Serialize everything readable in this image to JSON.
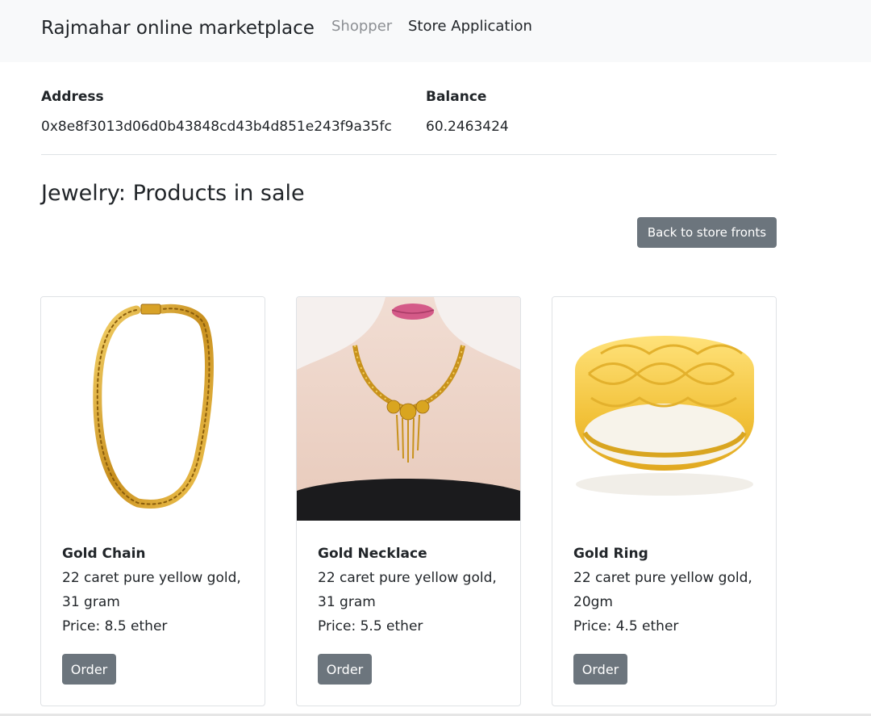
{
  "navbar": {
    "brand": "Rajmahar online marketplace",
    "links": [
      {
        "label": "Shopper"
      },
      {
        "label": "Store Application"
      }
    ]
  },
  "account": {
    "address_label": "Address",
    "address_value": "0x8e8f3013d06d0b43848cd43b4d851e243f9a35fc",
    "balance_label": "Balance",
    "balance_value": "60.2463424"
  },
  "page": {
    "title": "Jewelry: Products in sale",
    "back_button": "Back to store fronts"
  },
  "products": [
    {
      "name": "Gold Chain",
      "description": "22 caret pure yellow gold, 31 gram",
      "price": "Price: 8.5 ether",
      "order_label": "Order",
      "image": "gold-chain-image"
    },
    {
      "name": "Gold Necklace",
      "description": "22 caret pure yellow gold, 31 gram",
      "price": "Price: 5.5 ether",
      "order_label": "Order",
      "image": "gold-necklace-image"
    },
    {
      "name": "Gold Ring",
      "description": "22 caret pure yellow gold, 20gm",
      "price": "Price: 4.5 ether",
      "order_label": "Order",
      "image": "gold-ring-image"
    }
  ],
  "colors": {
    "navbar_bg": "#f8f9fa",
    "button_bg": "#6c757d",
    "gold": "#d9a520"
  }
}
